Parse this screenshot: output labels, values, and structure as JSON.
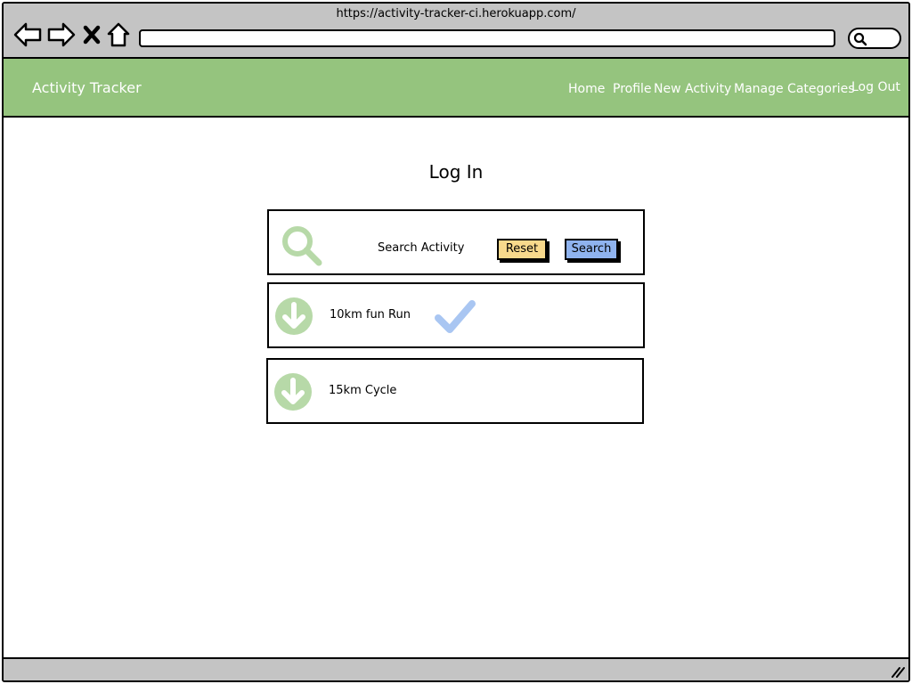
{
  "browser": {
    "url": "https://activity-tracker-ci.herokuapp.com/"
  },
  "navbar": {
    "brand": "Activity Tracker",
    "links": {
      "home": "Home",
      "profile": "Profile",
      "new_activity": "New Activity",
      "manage_categories": "Manage Categories",
      "log_out": "Log Out"
    }
  },
  "page": {
    "title": "Log In"
  },
  "search": {
    "label": "Search Activity",
    "reset_label": "Reset",
    "search_label": "Search",
    "icon": "search-icon"
  },
  "activities": [
    {
      "name": "10km fun Run",
      "icon": "arrow-down-circle-icon",
      "completed": true
    },
    {
      "name": "15km Cycle",
      "icon": "arrow-down-circle-icon",
      "completed": false
    }
  ],
  "colors": {
    "navbar": "#95c47e",
    "icon_green": "#b7d9a8",
    "check_blue": "#a9c6f2",
    "reset_button": "#f8d98c",
    "search_button": "#8fb3ef",
    "chrome": "#c4c4c4"
  }
}
